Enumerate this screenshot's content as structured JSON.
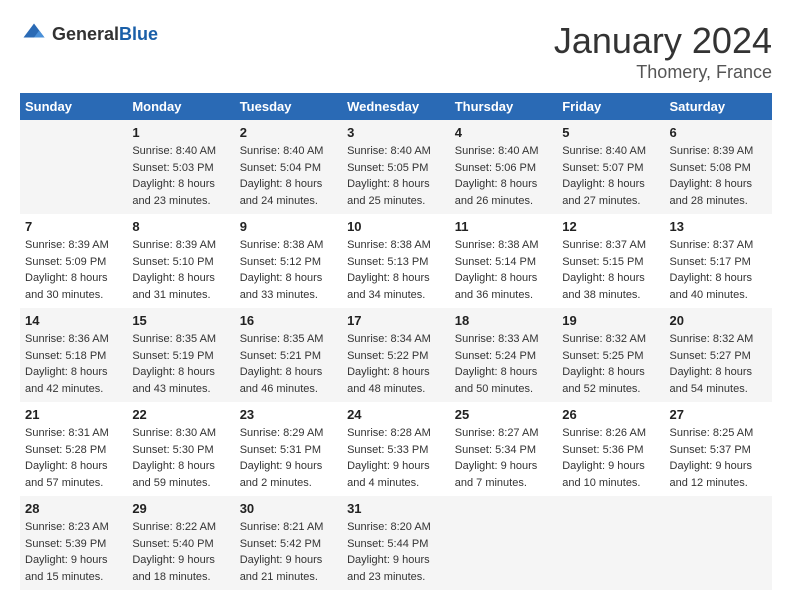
{
  "header": {
    "logo_general": "General",
    "logo_blue": "Blue",
    "month": "January 2024",
    "location": "Thomery, France"
  },
  "days_of_week": [
    "Sunday",
    "Monday",
    "Tuesday",
    "Wednesday",
    "Thursday",
    "Friday",
    "Saturday"
  ],
  "weeks": [
    [
      {
        "day": "",
        "sunrise": "",
        "sunset": "",
        "daylight": ""
      },
      {
        "day": "1",
        "sunrise": "Sunrise: 8:40 AM",
        "sunset": "Sunset: 5:03 PM",
        "daylight": "Daylight: 8 hours and 23 minutes."
      },
      {
        "day": "2",
        "sunrise": "Sunrise: 8:40 AM",
        "sunset": "Sunset: 5:04 PM",
        "daylight": "Daylight: 8 hours and 24 minutes."
      },
      {
        "day": "3",
        "sunrise": "Sunrise: 8:40 AM",
        "sunset": "Sunset: 5:05 PM",
        "daylight": "Daylight: 8 hours and 25 minutes."
      },
      {
        "day": "4",
        "sunrise": "Sunrise: 8:40 AM",
        "sunset": "Sunset: 5:06 PM",
        "daylight": "Daylight: 8 hours and 26 minutes."
      },
      {
        "day": "5",
        "sunrise": "Sunrise: 8:40 AM",
        "sunset": "Sunset: 5:07 PM",
        "daylight": "Daylight: 8 hours and 27 minutes."
      },
      {
        "day": "6",
        "sunrise": "Sunrise: 8:39 AM",
        "sunset": "Sunset: 5:08 PM",
        "daylight": "Daylight: 8 hours and 28 minutes."
      }
    ],
    [
      {
        "day": "7",
        "sunrise": "Sunrise: 8:39 AM",
        "sunset": "Sunset: 5:09 PM",
        "daylight": "Daylight: 8 hours and 30 minutes."
      },
      {
        "day": "8",
        "sunrise": "Sunrise: 8:39 AM",
        "sunset": "Sunset: 5:10 PM",
        "daylight": "Daylight: 8 hours and 31 minutes."
      },
      {
        "day": "9",
        "sunrise": "Sunrise: 8:38 AM",
        "sunset": "Sunset: 5:12 PM",
        "daylight": "Daylight: 8 hours and 33 minutes."
      },
      {
        "day": "10",
        "sunrise": "Sunrise: 8:38 AM",
        "sunset": "Sunset: 5:13 PM",
        "daylight": "Daylight: 8 hours and 34 minutes."
      },
      {
        "day": "11",
        "sunrise": "Sunrise: 8:38 AM",
        "sunset": "Sunset: 5:14 PM",
        "daylight": "Daylight: 8 hours and 36 minutes."
      },
      {
        "day": "12",
        "sunrise": "Sunrise: 8:37 AM",
        "sunset": "Sunset: 5:15 PM",
        "daylight": "Daylight: 8 hours and 38 minutes."
      },
      {
        "day": "13",
        "sunrise": "Sunrise: 8:37 AM",
        "sunset": "Sunset: 5:17 PM",
        "daylight": "Daylight: 8 hours and 40 minutes."
      }
    ],
    [
      {
        "day": "14",
        "sunrise": "Sunrise: 8:36 AM",
        "sunset": "Sunset: 5:18 PM",
        "daylight": "Daylight: 8 hours and 42 minutes."
      },
      {
        "day": "15",
        "sunrise": "Sunrise: 8:35 AM",
        "sunset": "Sunset: 5:19 PM",
        "daylight": "Daylight: 8 hours and 43 minutes."
      },
      {
        "day": "16",
        "sunrise": "Sunrise: 8:35 AM",
        "sunset": "Sunset: 5:21 PM",
        "daylight": "Daylight: 8 hours and 46 minutes."
      },
      {
        "day": "17",
        "sunrise": "Sunrise: 8:34 AM",
        "sunset": "Sunset: 5:22 PM",
        "daylight": "Daylight: 8 hours and 48 minutes."
      },
      {
        "day": "18",
        "sunrise": "Sunrise: 8:33 AM",
        "sunset": "Sunset: 5:24 PM",
        "daylight": "Daylight: 8 hours and 50 minutes."
      },
      {
        "day": "19",
        "sunrise": "Sunrise: 8:32 AM",
        "sunset": "Sunset: 5:25 PM",
        "daylight": "Daylight: 8 hours and 52 minutes."
      },
      {
        "day": "20",
        "sunrise": "Sunrise: 8:32 AM",
        "sunset": "Sunset: 5:27 PM",
        "daylight": "Daylight: 8 hours and 54 minutes."
      }
    ],
    [
      {
        "day": "21",
        "sunrise": "Sunrise: 8:31 AM",
        "sunset": "Sunset: 5:28 PM",
        "daylight": "Daylight: 8 hours and 57 minutes."
      },
      {
        "day": "22",
        "sunrise": "Sunrise: 8:30 AM",
        "sunset": "Sunset: 5:30 PM",
        "daylight": "Daylight: 8 hours and 59 minutes."
      },
      {
        "day": "23",
        "sunrise": "Sunrise: 8:29 AM",
        "sunset": "Sunset: 5:31 PM",
        "daylight": "Daylight: 9 hours and 2 minutes."
      },
      {
        "day": "24",
        "sunrise": "Sunrise: 8:28 AM",
        "sunset": "Sunset: 5:33 PM",
        "daylight": "Daylight: 9 hours and 4 minutes."
      },
      {
        "day": "25",
        "sunrise": "Sunrise: 8:27 AM",
        "sunset": "Sunset: 5:34 PM",
        "daylight": "Daylight: 9 hours and 7 minutes."
      },
      {
        "day": "26",
        "sunrise": "Sunrise: 8:26 AM",
        "sunset": "Sunset: 5:36 PM",
        "daylight": "Daylight: 9 hours and 10 minutes."
      },
      {
        "day": "27",
        "sunrise": "Sunrise: 8:25 AM",
        "sunset": "Sunset: 5:37 PM",
        "daylight": "Daylight: 9 hours and 12 minutes."
      }
    ],
    [
      {
        "day": "28",
        "sunrise": "Sunrise: 8:23 AM",
        "sunset": "Sunset: 5:39 PM",
        "daylight": "Daylight: 9 hours and 15 minutes."
      },
      {
        "day": "29",
        "sunrise": "Sunrise: 8:22 AM",
        "sunset": "Sunset: 5:40 PM",
        "daylight": "Daylight: 9 hours and 18 minutes."
      },
      {
        "day": "30",
        "sunrise": "Sunrise: 8:21 AM",
        "sunset": "Sunset: 5:42 PM",
        "daylight": "Daylight: 9 hours and 21 minutes."
      },
      {
        "day": "31",
        "sunrise": "Sunrise: 8:20 AM",
        "sunset": "Sunset: 5:44 PM",
        "daylight": "Daylight: 9 hours and 23 minutes."
      },
      {
        "day": "",
        "sunrise": "",
        "sunset": "",
        "daylight": ""
      },
      {
        "day": "",
        "sunrise": "",
        "sunset": "",
        "daylight": ""
      },
      {
        "day": "",
        "sunrise": "",
        "sunset": "",
        "daylight": ""
      }
    ]
  ]
}
